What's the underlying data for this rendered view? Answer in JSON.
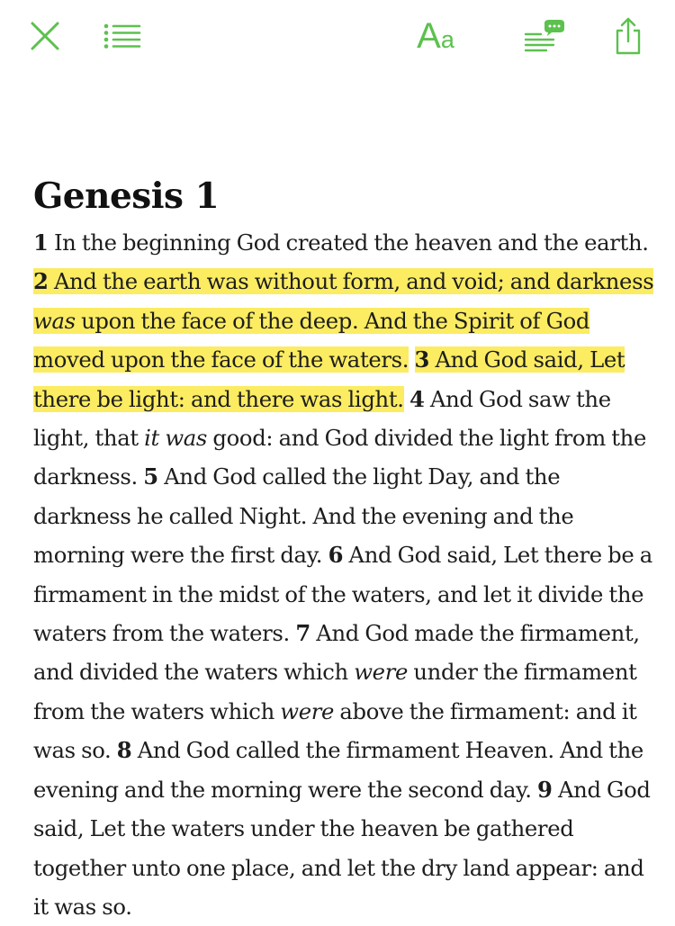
{
  "toolbar": {
    "close_icon": "close-icon",
    "toc_icon": "list-icon",
    "font_label_big": "A",
    "font_label_small": "a",
    "comments_icon": "comments-icon",
    "share_icon": "share-icon",
    "accent_color": "#5cc14e"
  },
  "chapter": {
    "title": "Genesis 1",
    "highlight_color": "#fbec62",
    "verses": [
      {
        "num": "1",
        "highlighted": false,
        "parts": [
          [
            "t",
            "In the beginning God created the heaven and the earth."
          ]
        ]
      },
      {
        "num": "2",
        "highlighted": true,
        "parts": [
          [
            "t",
            "And the earth was without form, and void; and darkness "
          ],
          [
            "i",
            "was"
          ],
          [
            "t",
            " upon the face of the deep. And the Spirit of God moved upon the face of the waters."
          ]
        ]
      },
      {
        "num": "3",
        "highlighted": true,
        "parts": [
          [
            "t",
            "And God said, Let there be light: and there was light."
          ]
        ]
      },
      {
        "num": "4",
        "highlighted": false,
        "parts": [
          [
            "t",
            "And God saw the light, that "
          ],
          [
            "i",
            "it was"
          ],
          [
            "t",
            " good: and God divided the light from the darkness."
          ]
        ]
      },
      {
        "num": "5",
        "highlighted": false,
        "parts": [
          [
            "t",
            "And God called the light Day, and the darkness he called Night. And the evening and the morning were the first day."
          ]
        ]
      },
      {
        "num": "6",
        "highlighted": false,
        "parts": [
          [
            "t",
            "And God said, Let there be a firmament in the midst of the waters, and let it divide the waters from the waters."
          ]
        ]
      },
      {
        "num": "7",
        "highlighted": false,
        "parts": [
          [
            "t",
            "And God made the firmament, and divided the waters which "
          ],
          [
            "i",
            "were"
          ],
          [
            "t",
            " under the firmament from the waters which "
          ],
          [
            "i",
            "were"
          ],
          [
            "t",
            " above the firmament: and it was so."
          ]
        ]
      },
      {
        "num": "8",
        "highlighted": false,
        "parts": [
          [
            "t",
            "And God called the firmament Heaven. And the evening and the morning were the second day."
          ]
        ]
      },
      {
        "num": "9",
        "highlighted": false,
        "parts": [
          [
            "t",
            "And God said, Let the waters under the heaven be gathered together unto one place, and let the dry land appear: and it was so."
          ]
        ]
      }
    ]
  }
}
